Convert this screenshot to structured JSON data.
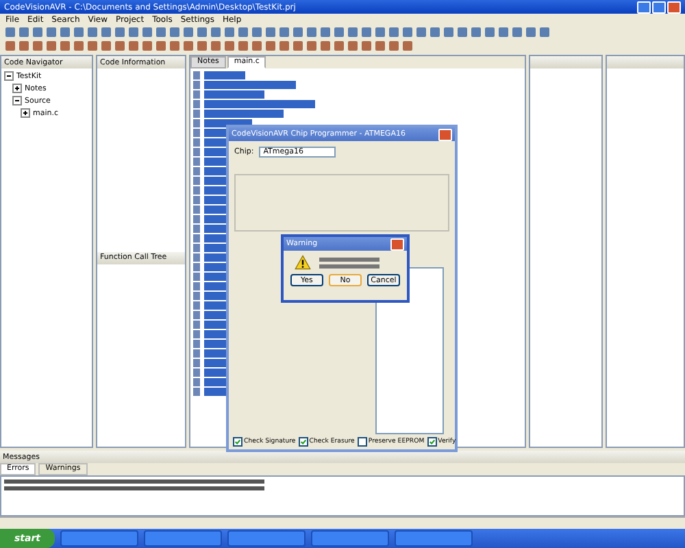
{
  "window": {
    "title": "CodeVisionAVR - C:\\Documents and Settings\\Admin\\Desktop\\TestKit.prj"
  },
  "menu": [
    "File",
    "Edit",
    "Search",
    "View",
    "Project",
    "Tools",
    "Settings",
    "Help"
  ],
  "panels": [
    {
      "title": "Code Navigator"
    },
    {
      "title": "Code Information"
    },
    {
      "title": "Function Call Tree"
    }
  ],
  "tree": [
    {
      "label": "TestKit",
      "expanded": true,
      "children": [
        {
          "label": "Notes",
          "expanded": false
        },
        {
          "label": "Source",
          "expanded": true,
          "children": [
            {
              "label": "main.c",
              "expanded": false
            }
          ]
        }
      ]
    }
  ],
  "editor": {
    "tabs": [
      {
        "label": "Notes",
        "selected": false
      },
      {
        "label": "main.c",
        "selected": true
      }
    ]
  },
  "programmer": {
    "title": "CodeVisionAVR Chip Programmer - ATMEGA16",
    "chip_label": "Chip:",
    "chip": "ATmega16",
    "checkboxes": [
      {
        "label": "Check Signature",
        "checked": true
      },
      {
        "label": "Check Erasure",
        "checked": true
      },
      {
        "label": "Preserve EEPROM",
        "checked": false
      },
      {
        "label": "Verify",
        "checked": true
      }
    ]
  },
  "warning": {
    "title": "Warning",
    "buttons": [
      {
        "label": "Yes",
        "selected": false
      },
      {
        "label": "No",
        "selected": true
      },
      {
        "label": "Cancel",
        "selected": false
      }
    ]
  },
  "messages": {
    "title": "Messages",
    "tabs": [
      {
        "label": "Errors",
        "selected": true
      },
      {
        "label": "Warnings",
        "selected": false
      }
    ]
  },
  "taskbar": {
    "start": "start"
  }
}
